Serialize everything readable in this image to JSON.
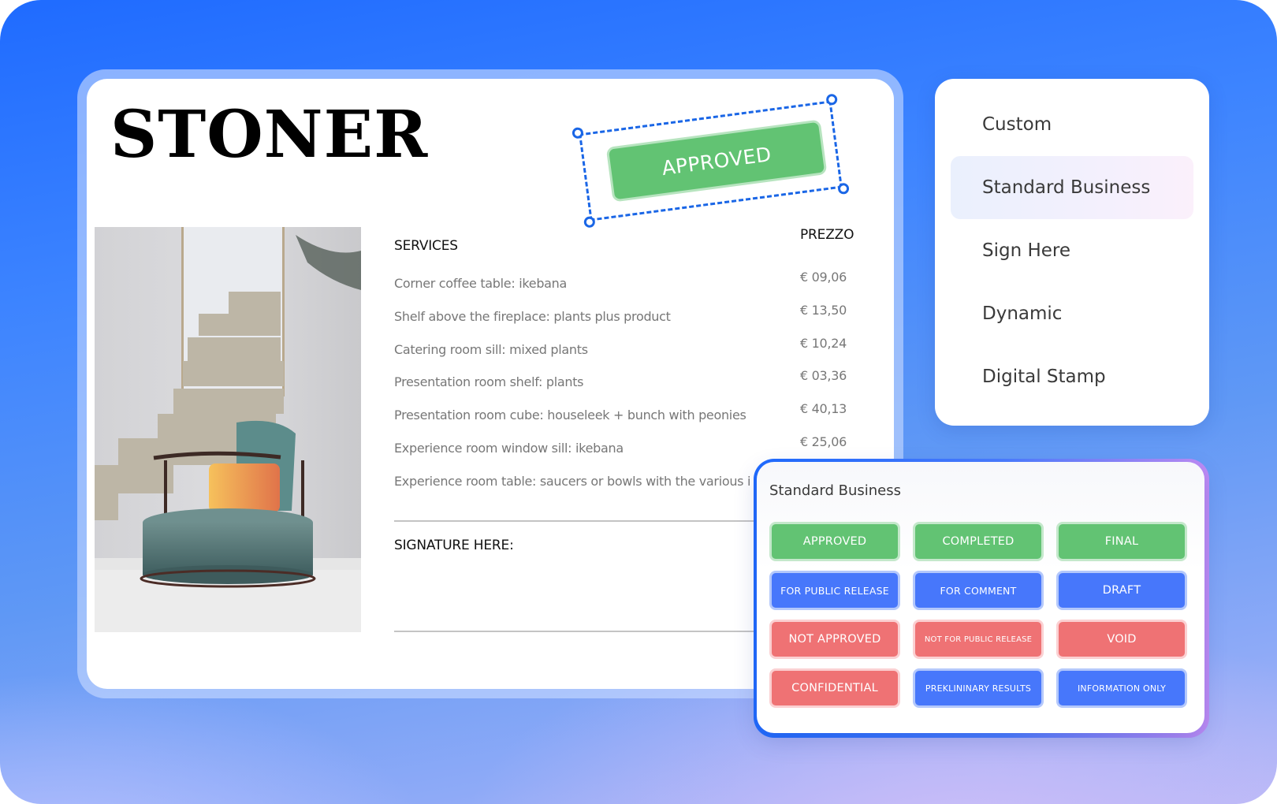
{
  "document": {
    "brand": "STONER",
    "services_header": "SERVICES",
    "price_header": "PREZZO",
    "services": [
      {
        "name": "Corner coffee table: ikebana",
        "price": "€ 09,06"
      },
      {
        "name": "Shelf above the fireplace: plants plus product",
        "price": "€ 13,50"
      },
      {
        "name": "Catering room sill: mixed plants",
        "price": "€ 10,24"
      },
      {
        "name": "Presentation room shelf: plants",
        "price": "€ 03,36"
      },
      {
        "name": "Presentation room cube: houseleek + bunch with peonies",
        "price": "€ 40,13"
      },
      {
        "name": "Experience room window sill: ikebana",
        "price": "€ 25,06"
      },
      {
        "name": "Experience room table: saucers or bowls with the various i",
        "price": ""
      }
    ],
    "signature_label": "SIGNATURE HERE:",
    "placed_stamp": {
      "label": "APPROVED",
      "color": "#62c373"
    },
    "photo_alt": "interior-photo-armchair-stairs"
  },
  "stamp_categories": {
    "items": [
      {
        "label": "Custom",
        "active": false
      },
      {
        "label": "Standard Business",
        "active": true
      },
      {
        "label": "Sign Here",
        "active": false
      },
      {
        "label": "Dynamic",
        "active": false
      },
      {
        "label": "Digital Stamp",
        "active": false
      }
    ]
  },
  "stamp_panel": {
    "title": "Standard Business",
    "stamps": [
      {
        "label": "APPROVED",
        "color": "green"
      },
      {
        "label": "COMPLETED",
        "color": "green"
      },
      {
        "label": "FINAL",
        "color": "green"
      },
      {
        "label": "FOR PUBLIC RELEASE",
        "color": "blue"
      },
      {
        "label": "FOR COMMENT",
        "color": "blue"
      },
      {
        "label": "DRAFT",
        "color": "blue"
      },
      {
        "label": "NOT APPROVED",
        "color": "red"
      },
      {
        "label": "NOT FOR PUBLIC RELEASE",
        "color": "red"
      },
      {
        "label": "VOID",
        "color": "red"
      },
      {
        "label": "CONFIDENTIAL",
        "color": "red"
      },
      {
        "label": "PREKLININARY RESULTS",
        "color": "blue"
      },
      {
        "label": "INFORMATION ONLY",
        "color": "blue"
      }
    ]
  },
  "colors": {
    "green": "#62c373",
    "blue": "#4777fb",
    "red": "#ef7274",
    "selection": "#1a66e6",
    "background": "#1f6bff"
  }
}
